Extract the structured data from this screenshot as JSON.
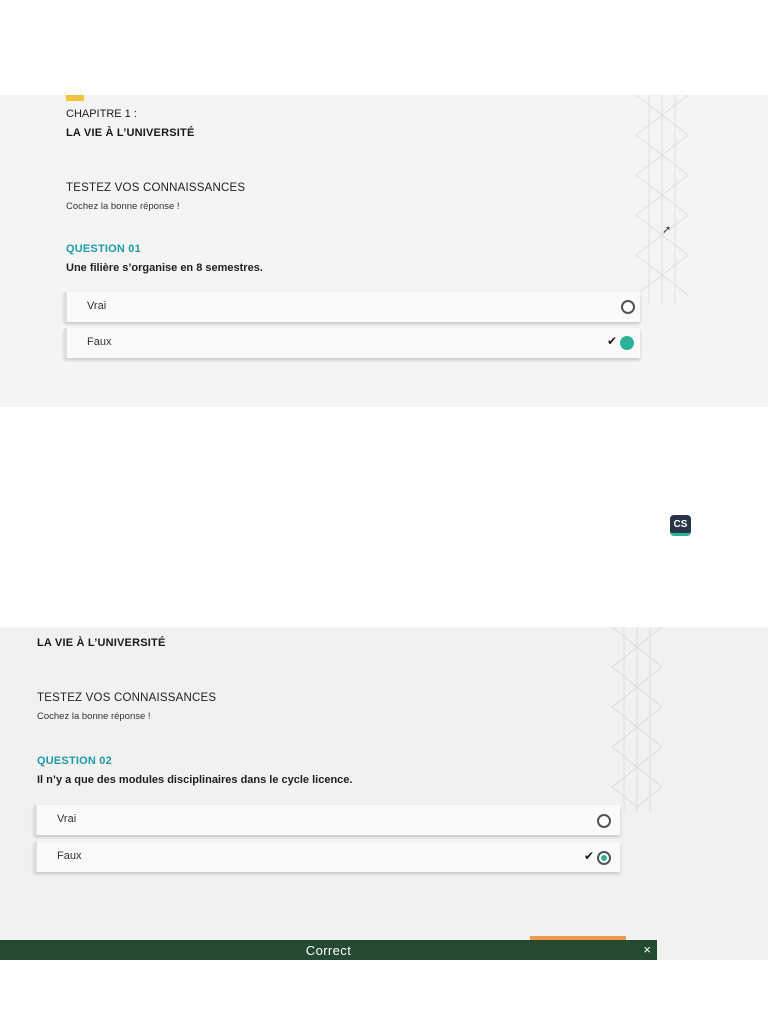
{
  "screen1": {
    "chapter": "CHAPITRE 1 :",
    "title": "LA VIE À L’UNIVERSITÉ",
    "section_title": "TESTEZ VOS CONNAISSANCES",
    "instruction": "Cochez la bonne réponse !",
    "question_number": "QUESTION 01",
    "question_text": "Une filière s’organise en 8 semestres.",
    "options": [
      {
        "label": "Vrai",
        "selected": false
      },
      {
        "label": "Faux",
        "selected": true
      }
    ],
    "check_glyph": "✔"
  },
  "badge": {
    "text": "CS"
  },
  "screen2": {
    "title": "LA VIE À L’UNIVERSITÉ",
    "section_title": "TESTEZ VOS CONNAISSANCES",
    "instruction": "Cochez la bonne réponse !",
    "question_number": "QUESTION 02",
    "question_text": "Il n’y a que des modules disciplinaires dans le cycle licence.",
    "options": [
      {
        "label": "Vrai",
        "selected": false
      },
      {
        "label": "Faux",
        "selected": true
      }
    ],
    "check_glyph": "✔"
  },
  "feedback": {
    "text": "Correct",
    "close_glyph": "×"
  },
  "colors": {
    "accent_teal": "#1e9aab",
    "selected_green": "#2bb39a",
    "accent_yellow": "#f2c33c",
    "feedback_bg": "#244a32"
  }
}
